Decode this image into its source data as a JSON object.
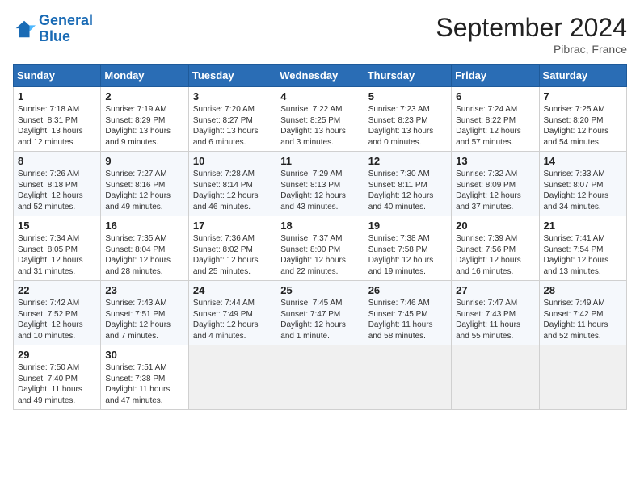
{
  "logo": {
    "line1": "General",
    "line2": "Blue"
  },
  "title": "September 2024",
  "location": "Pibrac, France",
  "headers": [
    "Sunday",
    "Monday",
    "Tuesday",
    "Wednesday",
    "Thursday",
    "Friday",
    "Saturday"
  ],
  "weeks": [
    [
      {
        "day": "1",
        "info": "Sunrise: 7:18 AM\nSunset: 8:31 PM\nDaylight: 13 hours\nand 12 minutes."
      },
      {
        "day": "2",
        "info": "Sunrise: 7:19 AM\nSunset: 8:29 PM\nDaylight: 13 hours\nand 9 minutes."
      },
      {
        "day": "3",
        "info": "Sunrise: 7:20 AM\nSunset: 8:27 PM\nDaylight: 13 hours\nand 6 minutes."
      },
      {
        "day": "4",
        "info": "Sunrise: 7:22 AM\nSunset: 8:25 PM\nDaylight: 13 hours\nand 3 minutes."
      },
      {
        "day": "5",
        "info": "Sunrise: 7:23 AM\nSunset: 8:23 PM\nDaylight: 13 hours\nand 0 minutes."
      },
      {
        "day": "6",
        "info": "Sunrise: 7:24 AM\nSunset: 8:22 PM\nDaylight: 12 hours\nand 57 minutes."
      },
      {
        "day": "7",
        "info": "Sunrise: 7:25 AM\nSunset: 8:20 PM\nDaylight: 12 hours\nand 54 minutes."
      }
    ],
    [
      {
        "day": "8",
        "info": "Sunrise: 7:26 AM\nSunset: 8:18 PM\nDaylight: 12 hours\nand 52 minutes."
      },
      {
        "day": "9",
        "info": "Sunrise: 7:27 AM\nSunset: 8:16 PM\nDaylight: 12 hours\nand 49 minutes."
      },
      {
        "day": "10",
        "info": "Sunrise: 7:28 AM\nSunset: 8:14 PM\nDaylight: 12 hours\nand 46 minutes."
      },
      {
        "day": "11",
        "info": "Sunrise: 7:29 AM\nSunset: 8:13 PM\nDaylight: 12 hours\nand 43 minutes."
      },
      {
        "day": "12",
        "info": "Sunrise: 7:30 AM\nSunset: 8:11 PM\nDaylight: 12 hours\nand 40 minutes."
      },
      {
        "day": "13",
        "info": "Sunrise: 7:32 AM\nSunset: 8:09 PM\nDaylight: 12 hours\nand 37 minutes."
      },
      {
        "day": "14",
        "info": "Sunrise: 7:33 AM\nSunset: 8:07 PM\nDaylight: 12 hours\nand 34 minutes."
      }
    ],
    [
      {
        "day": "15",
        "info": "Sunrise: 7:34 AM\nSunset: 8:05 PM\nDaylight: 12 hours\nand 31 minutes."
      },
      {
        "day": "16",
        "info": "Sunrise: 7:35 AM\nSunset: 8:04 PM\nDaylight: 12 hours\nand 28 minutes."
      },
      {
        "day": "17",
        "info": "Sunrise: 7:36 AM\nSunset: 8:02 PM\nDaylight: 12 hours\nand 25 minutes."
      },
      {
        "day": "18",
        "info": "Sunrise: 7:37 AM\nSunset: 8:00 PM\nDaylight: 12 hours\nand 22 minutes."
      },
      {
        "day": "19",
        "info": "Sunrise: 7:38 AM\nSunset: 7:58 PM\nDaylight: 12 hours\nand 19 minutes."
      },
      {
        "day": "20",
        "info": "Sunrise: 7:39 AM\nSunset: 7:56 PM\nDaylight: 12 hours\nand 16 minutes."
      },
      {
        "day": "21",
        "info": "Sunrise: 7:41 AM\nSunset: 7:54 PM\nDaylight: 12 hours\nand 13 minutes."
      }
    ],
    [
      {
        "day": "22",
        "info": "Sunrise: 7:42 AM\nSunset: 7:52 PM\nDaylight: 12 hours\nand 10 minutes."
      },
      {
        "day": "23",
        "info": "Sunrise: 7:43 AM\nSunset: 7:51 PM\nDaylight: 12 hours\nand 7 minutes."
      },
      {
        "day": "24",
        "info": "Sunrise: 7:44 AM\nSunset: 7:49 PM\nDaylight: 12 hours\nand 4 minutes."
      },
      {
        "day": "25",
        "info": "Sunrise: 7:45 AM\nSunset: 7:47 PM\nDaylight: 12 hours\nand 1 minute."
      },
      {
        "day": "26",
        "info": "Sunrise: 7:46 AM\nSunset: 7:45 PM\nDaylight: 11 hours\nand 58 minutes."
      },
      {
        "day": "27",
        "info": "Sunrise: 7:47 AM\nSunset: 7:43 PM\nDaylight: 11 hours\nand 55 minutes."
      },
      {
        "day": "28",
        "info": "Sunrise: 7:49 AM\nSunset: 7:42 PM\nDaylight: 11 hours\nand 52 minutes."
      }
    ],
    [
      {
        "day": "29",
        "info": "Sunrise: 7:50 AM\nSunset: 7:40 PM\nDaylight: 11 hours\nand 49 minutes."
      },
      {
        "day": "30",
        "info": "Sunrise: 7:51 AM\nSunset: 7:38 PM\nDaylight: 11 hours\nand 47 minutes."
      },
      null,
      null,
      null,
      null,
      null
    ]
  ]
}
